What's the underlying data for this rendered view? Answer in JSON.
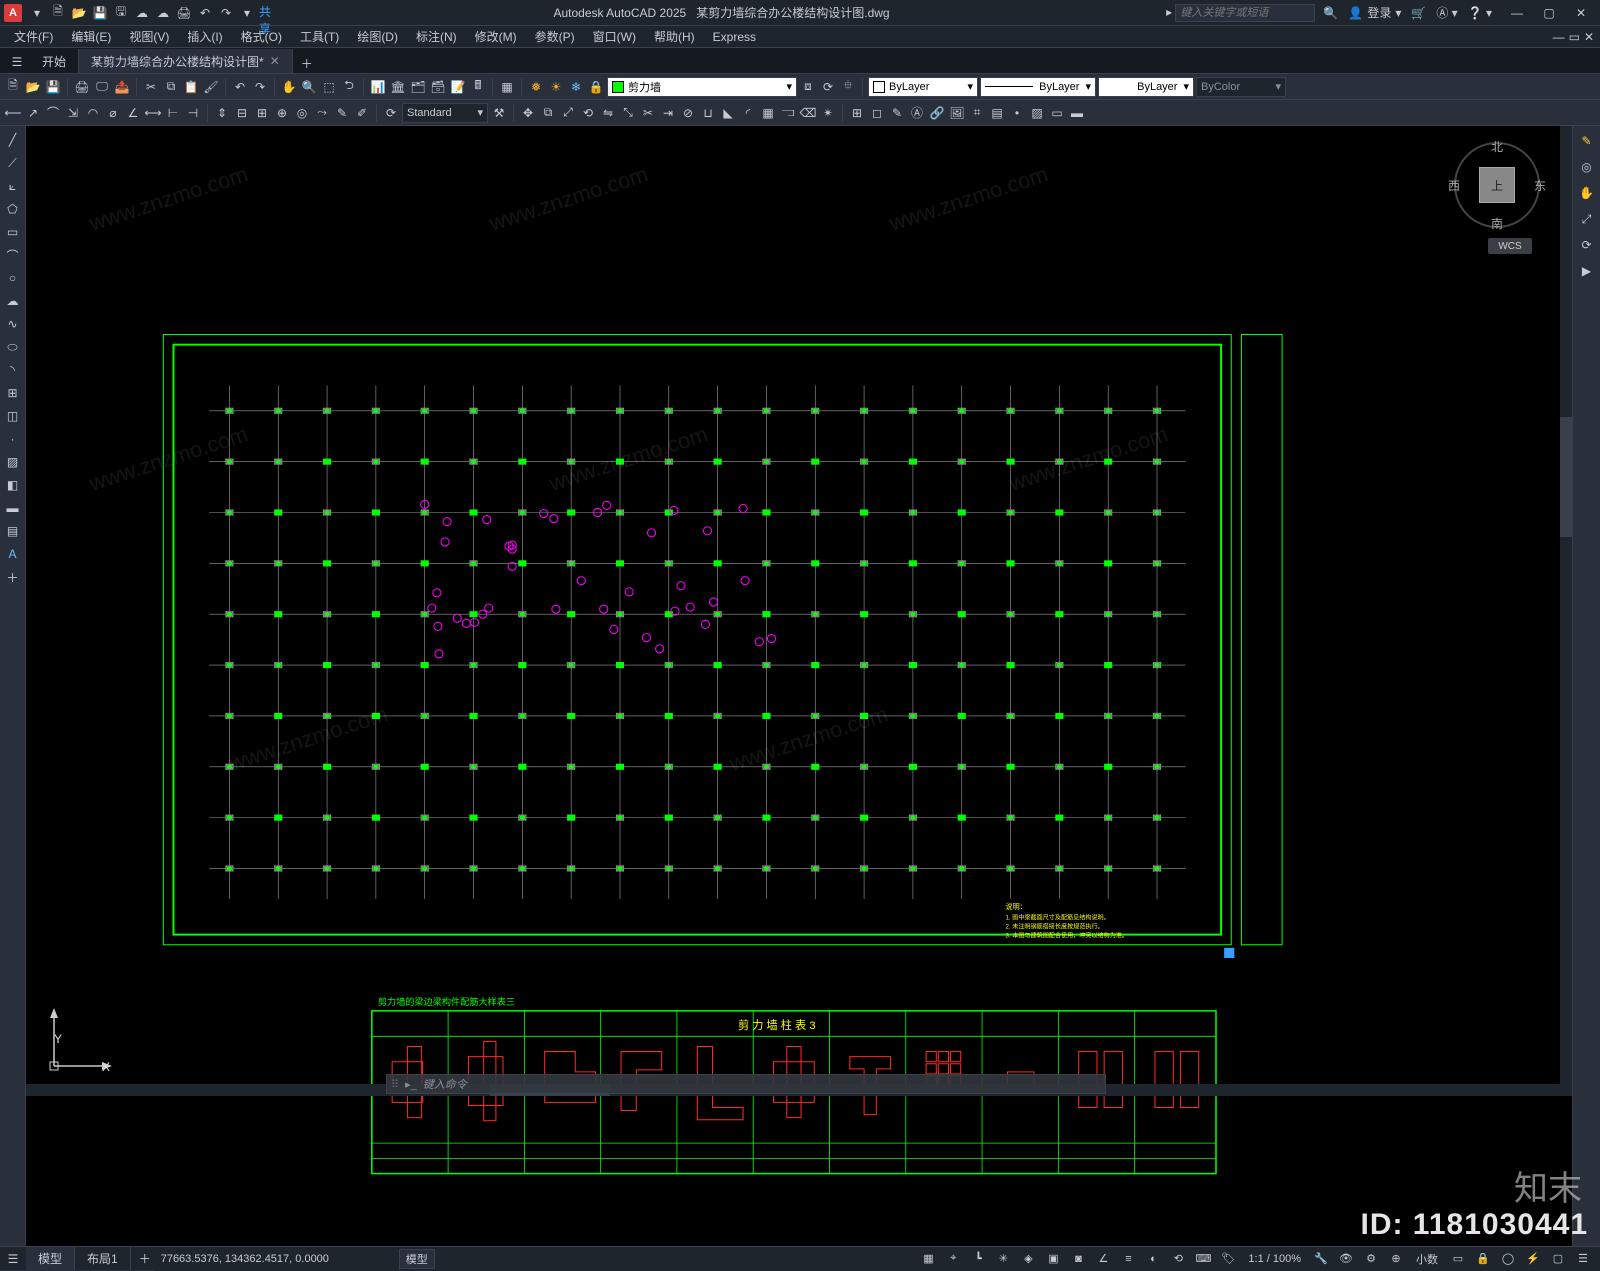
{
  "title": {
    "app": "Autodesk AutoCAD 2025",
    "doc": "某剪力墙综合办公楼结构设计图.dwg",
    "search_placeholder": "键入关键字或短语",
    "login": "登录"
  },
  "menubar": [
    "文件(F)",
    "编辑(E)",
    "视图(V)",
    "插入(I)",
    "格式(O)",
    "工具(T)",
    "绘图(D)",
    "标注(N)",
    "修改(M)",
    "参数(P)",
    "窗口(W)",
    "帮助(H)",
    "Express"
  ],
  "doctabs": {
    "start": "开始",
    "active": "某剪力墙综合办公楼结构设计图*"
  },
  "ribbon": {
    "layer_current": "剪力墙",
    "layer_color": "#00ff00",
    "prop_color": "ByLayer",
    "prop_linetype": "ByLayer",
    "prop_lineweight": "ByLayer",
    "plot_style": "ByColor",
    "text_style": "Standard"
  },
  "viewcube": {
    "top": "上",
    "n": "北",
    "s": "南",
    "e": "东",
    "w": "西"
  },
  "wcs": "WCS",
  "ucs": {
    "x": "X",
    "y": "Y"
  },
  "command": {
    "prompt": "键入命令"
  },
  "layout_tabs": {
    "model": "模型",
    "layout1": "布局1"
  },
  "statusbar": {
    "coords": "77663.5376, 134362.4517, 0.0000",
    "model": "模型",
    "scale": "1:1 / 100%",
    "units": "小数"
  },
  "drawing": {
    "border_color": "#00ff00",
    "grid_color": "#c0c0c0",
    "marker_color": "#00ff00",
    "circle_color": "#ff00ff",
    "table_title": "剪力墙的梁边梁构件配筋大样表三",
    "table_header": "剪 力 墙 柱 表 3",
    "note_color": "#ffff00"
  },
  "overlay": {
    "brand": "知末",
    "id_label": "ID: 1181030441",
    "watermark": "www.znzmo.com"
  }
}
